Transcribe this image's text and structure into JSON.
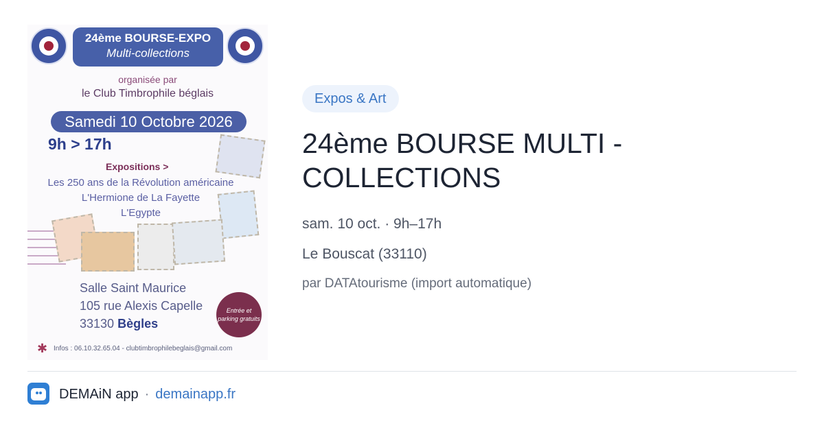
{
  "poster": {
    "title": "24ème BOURSE-EXPO",
    "subtitle": "Multi-collections",
    "organised_by": "organisée par",
    "club": "le Club Timbrophile béglais",
    "date": "Samedi 10 Octobre 2026",
    "hours": "9h > 17h",
    "expositions_heading": "Expositions >",
    "expositions": [
      "Les 250 ans de la Révolution américaine",
      "L'Hermione de La Fayette",
      "L'Egypte"
    ],
    "address": [
      "Salle Saint Maurice",
      "105 rue Alexis Capelle",
      "33130"
    ],
    "city": "Bègles",
    "entry_badge": "Entrée et parking gratuits",
    "infos": "Infos : 06.10.32.65.04 - clubtimbrophilebeglais@gmail.com",
    "colors": {
      "primary": "#4760a9",
      "accent": "#7b2f4d"
    }
  },
  "event": {
    "category": "Expos & Art",
    "title": "24ème BOURSE MULTI - COLLECTIONS",
    "datetime": "sam. 10 oct. · 9h–17h",
    "location": "Le Bouscat (33110)",
    "source": "par DATAtourisme (import automatique)"
  },
  "footer": {
    "app_icon": "demain-app-icon",
    "app_name": "DEMAiN app",
    "separator": "·",
    "link": "demainapp.fr"
  }
}
